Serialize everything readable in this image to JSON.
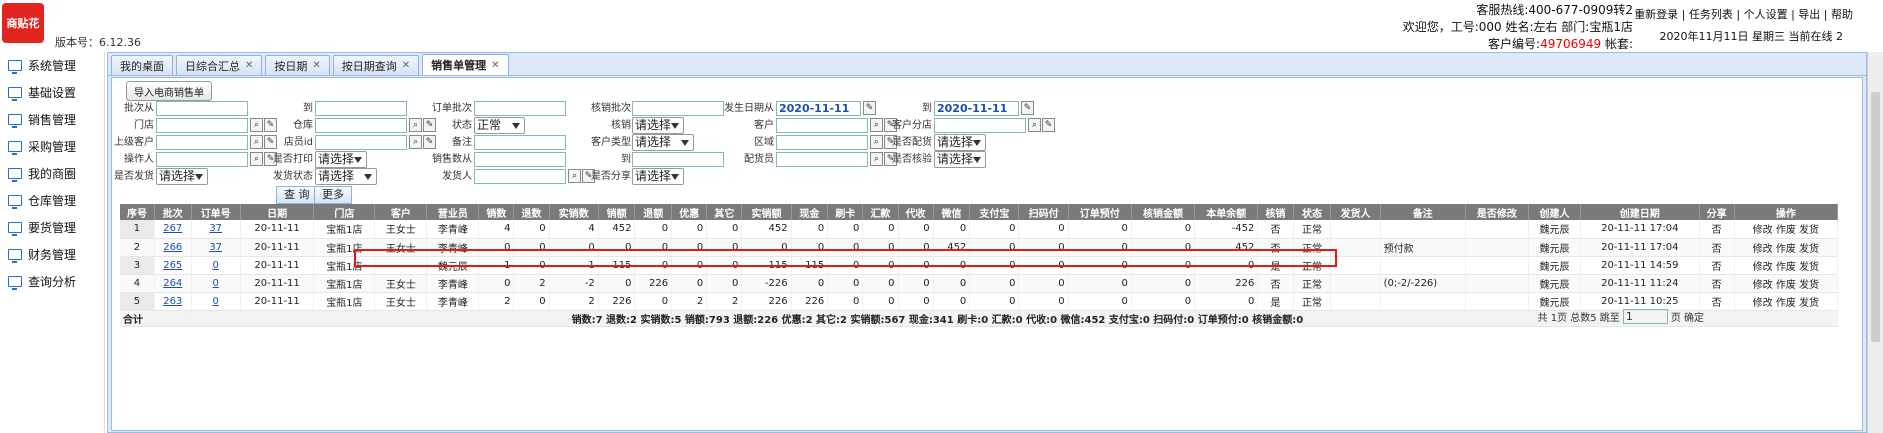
{
  "brand": {
    "logo_text": "商贴花",
    "version": "版本号：6.12.36"
  },
  "header": {
    "hotline": "客服热线:400-677-0909转2",
    "welcome_prefix": "欢迎您，工号:000 姓名:左右 部门:宝瓶1店",
    "customer_prefix": "客户编号:",
    "customer_no": "49706949",
    "account_label": " 帐套:",
    "links": [
      "重新登录",
      "任务列表",
      "个人设置",
      "导出",
      "帮助"
    ],
    "date_status": "2020年11月11日 星期三 当前在线 2"
  },
  "sidebar": {
    "items": [
      "系统管理",
      "基础设置",
      "销售管理",
      "采购管理",
      "我的商圈",
      "仓库管理",
      "要货管理",
      "财务管理",
      "查询分析"
    ]
  },
  "tabs": [
    {
      "label": "我的桌面",
      "closable": false
    },
    {
      "label": "日综合汇总",
      "closable": true
    },
    {
      "label": "按日期",
      "closable": true
    },
    {
      "label": "按日期查询",
      "closable": true
    },
    {
      "label": "销售单管理",
      "closable": true,
      "active": true
    }
  ],
  "form": {
    "import_label": "导入电商销售单",
    "labels": {
      "batch_from": "批次从",
      "to1": "到",
      "order_batch": "订单批次",
      "verify_batch": "核销批次",
      "ship_date_from": "发生日期从",
      "to2": "到",
      "store": "门店",
      "warehouse": "仓库",
      "status": "状态",
      "verify": "核销",
      "customer": "客户",
      "customer_branch": "客户分店",
      "parent_customer": "上级客户",
      "store_id": "店员id",
      "remark": "备注",
      "customer_type": "客户类型",
      "region": "区域",
      "is_delivery_assigned": "是否配货",
      "operator": "操作人",
      "is_printed": "是否打印",
      "sales_count": "销售数从",
      "to3": "到",
      "delivery_person": "配货员",
      "is_verified": "是否核验",
      "is_shipped": "是否发货",
      "ship_status": "发货状态",
      "shipper": "发货人",
      "is_shared": "是否分享"
    },
    "values": {
      "date_from": "2020-11-11",
      "date_to": "2020-11-11",
      "status": "正常",
      "select_placeholder": "请选择"
    },
    "query_label": "查 询",
    "more_label": "更多"
  },
  "table": {
    "columns": [
      "序号",
      "批次",
      "订单号",
      "日期",
      "门店",
      "客户",
      "营业员",
      "销数",
      "退数",
      "实销数",
      "销额",
      "退额",
      "优惠",
      "其它",
      "实销额",
      "现金",
      "刷卡",
      "汇款",
      "代收",
      "微信",
      "支付宝",
      "扫码付",
      "订单预付",
      "核销金额",
      "本单余额",
      "核销",
      "状态",
      "发货人",
      "备注",
      "是否修改",
      "创建人",
      "创建日期",
      "分享",
      "操作"
    ],
    "rows": [
      [
        "1",
        "267",
        "37",
        "20-11-11",
        "宝瓶1店",
        "王女士",
        "李青峰",
        "4",
        "0",
        "4",
        "452",
        "0",
        "0",
        "0",
        "452",
        "0",
        "0",
        "0",
        "0",
        "0",
        "0",
        "0",
        "0",
        "0",
        "-452",
        "否",
        "正常",
        "",
        "",
        "",
        "魏元辰",
        "20-11-11 17:04",
        "否",
        "修改 作废 发货"
      ],
      [
        "2",
        "266",
        "37",
        "20-11-11",
        "宝瓶1店",
        "王女士",
        "李青峰",
        "0",
        "0",
        "0",
        "0",
        "0",
        "0",
        "0",
        "0",
        "0",
        "0",
        "0",
        "0",
        "452",
        "0",
        "0",
        "0",
        "0",
        "452",
        "否",
        "正常",
        "",
        "预付款",
        "",
        "魏元辰",
        "20-11-11 17:04",
        "否",
        "修改 作废 发货"
      ],
      [
        "3",
        "265",
        "0",
        "20-11-11",
        "宝瓶1店",
        "",
        "魏元辰",
        "1",
        "0",
        "1",
        "115",
        "0",
        "0",
        "0",
        "115",
        "115",
        "0",
        "0",
        "0",
        "0",
        "0",
        "0",
        "0",
        "0",
        "0",
        "是",
        "正常",
        "",
        "",
        "",
        "魏元辰",
        "20-11-11 14:59",
        "否",
        "修改 作废 发货"
      ],
      [
        "4",
        "264",
        "0",
        "20-11-11",
        "宝瓶1店",
        "王女士",
        "李青峰",
        "0",
        "2",
        "-2",
        "0",
        "226",
        "0",
        "0",
        "-226",
        "0",
        "0",
        "0",
        "0",
        "0",
        "0",
        "0",
        "0",
        "0",
        "226",
        "否",
        "正常",
        "",
        "(0;-2/-226)",
        "",
        "魏元辰",
        "20-11-11 11:24",
        "否",
        "修改 作废 发货"
      ],
      [
        "5",
        "263",
        "0",
        "20-11-11",
        "宝瓶1店",
        "王女士",
        "李青峰",
        "2",
        "0",
        "2",
        "226",
        "0",
        "2",
        "2",
        "226",
        "226",
        "0",
        "0",
        "0",
        "0",
        "0",
        "0",
        "0",
        "0",
        "0",
        "是",
        "正常",
        "",
        "",
        "",
        "魏元辰",
        "20-11-11 10:25",
        "否",
        "修改 作废 发货"
      ]
    ],
    "sum_label": "合计",
    "sum_text": "销数:7 退数:2 实销数:5 销额:793 退额:226 优惠:2 其它:2 实销额:567 现金:341 刷卡:0 汇款:0 代收:0 微信:452 支付宝:0 扫码付:0 订单预付:0 核销金额:0"
  },
  "pager": {
    "summary": "共 1页 总数5 跳至",
    "page": "1",
    "suffix": "页 确定"
  }
}
